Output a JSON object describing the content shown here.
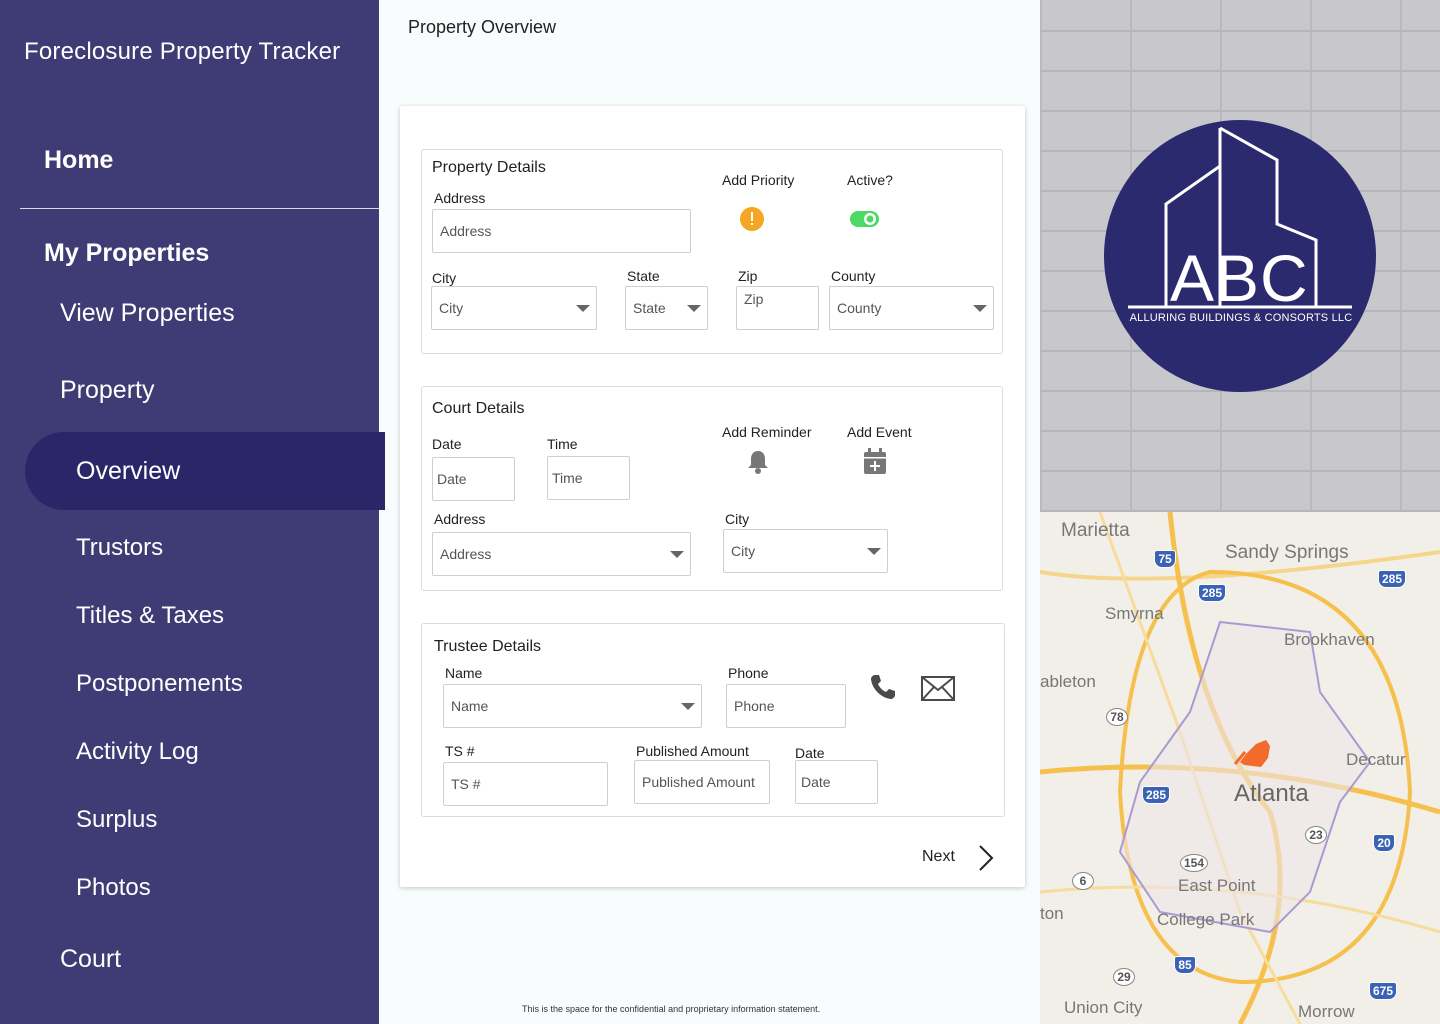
{
  "app": {
    "title": "Foreclosure Property Tracker"
  },
  "nav": {
    "home": "Home",
    "my_properties": "My Properties",
    "view_properties": "View Properties",
    "property": "Property",
    "overview": "Overview",
    "trustors": "Trustors",
    "titles_taxes": "Titles & Taxes",
    "postponements": "Postponements",
    "activity_log": "Activity Log",
    "surplus": "Surplus",
    "photos": "Photos",
    "court": "Court"
  },
  "page": {
    "title": "Property Overview"
  },
  "property_details": {
    "title": "Property Details",
    "address_label": "Address",
    "address_placeholder": "Address",
    "add_priority_label": "Add Priority",
    "active_label": "Active?",
    "city_label": "City",
    "city_placeholder": "City",
    "state_label": "State",
    "state_placeholder": "State",
    "zip_label": "Zip",
    "zip_placeholder": "Zip",
    "county_label": "County",
    "county_placeholder": "County",
    "priority_color": "#f5a623",
    "active_color": "#4cd964"
  },
  "court_details": {
    "title": "Court Details",
    "date_label": "Date",
    "date_placeholder": "Date",
    "time_label": "Time",
    "time_placeholder": "Time",
    "add_reminder_label": "Add Reminder",
    "add_event_label": "Add Event",
    "address_label": "Address",
    "address_placeholder": "Address",
    "city_label": "City",
    "city_placeholder": "City"
  },
  "trustee_details": {
    "title": "Trustee Details",
    "name_label": "Name",
    "name_placeholder": "Name",
    "phone_label": "Phone",
    "phone_placeholder": "Phone",
    "ts_label": "TS #",
    "ts_placeholder": "TS #",
    "published_amount_label": "Published Amount",
    "published_amount_placeholder": "Published Amount",
    "date_label": "Date",
    "date_placeholder": "Date"
  },
  "actions": {
    "next_label": "Next"
  },
  "footer": {
    "text": "This is the space for the confidential and proprietary information statement."
  },
  "logo": {
    "letters": "ABC",
    "tagline": "ALLURING BUILDINGS & CONSORTS LLC"
  },
  "map": {
    "labels": [
      "Marietta",
      "Sandy Springs",
      "Smyrna",
      "Brookhaven",
      "ableton",
      "Decatur",
      "Atlanta",
      "East Point",
      "College Park",
      "Union City",
      "Morrow",
      "ton"
    ],
    "highways": [
      "75",
      "285",
      "285",
      "78",
      "285",
      "23",
      "20",
      "154",
      "6",
      "85",
      "29",
      "675"
    ]
  }
}
